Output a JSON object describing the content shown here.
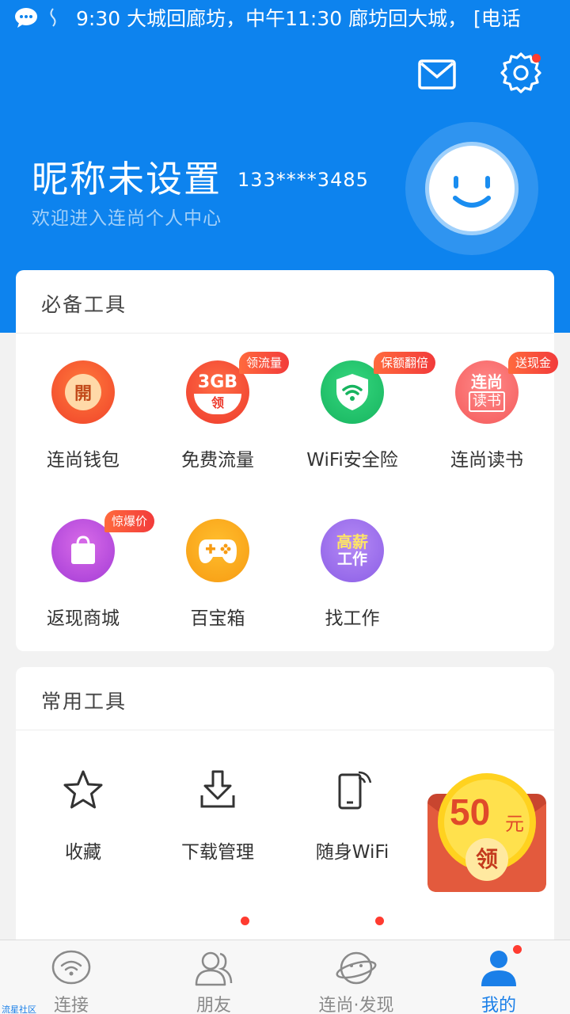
{
  "status_bar": {
    "ticker_text": "9:30 大城回廊坊，中午11:30 廊坊回大城， [电话"
  },
  "profile": {
    "nickname": "昵称未设置",
    "phone": "133****3485",
    "welcome": "欢迎进入连尚个人中心"
  },
  "essential_tools": {
    "title": "必备工具",
    "items": [
      {
        "label": "连尚钱包",
        "icon": "wallet-icon",
        "icon_text": "開",
        "badge": ""
      },
      {
        "label": "免费流量",
        "icon": "3gb-data-icon",
        "icon_text": "3GB",
        "icon_subtext": "领",
        "badge": "领流量"
      },
      {
        "label": "WiFi安全险",
        "icon": "wifi-shield-icon",
        "badge": "保额翻倍"
      },
      {
        "label": "连尚读书",
        "icon": "reading-icon",
        "icon_text": "连尚",
        "icon_subtext": "读书",
        "badge": "送现金"
      },
      {
        "label": "返现商城",
        "icon": "shopping-bag-icon",
        "badge": "惊爆价"
      },
      {
        "label": "百宝箱",
        "icon": "gamepad-icon",
        "badge": ""
      },
      {
        "label": "找工作",
        "icon": "job-icon",
        "icon_text": "高薪",
        "icon_subtext": "工作",
        "badge": ""
      }
    ]
  },
  "common_tools": {
    "title": "常用工具",
    "items": [
      {
        "label": "收藏",
        "icon": "star-icon"
      },
      {
        "label": "下载管理",
        "icon": "download-icon"
      },
      {
        "label": "随身WiFi",
        "icon": "phone-wifi-icon"
      }
    ]
  },
  "floating_pack": {
    "amount": "50",
    "unit": "元",
    "action": "领"
  },
  "tabs": [
    {
      "label": "连接",
      "icon": "wifi-icon",
      "active": false
    },
    {
      "label": "朋友",
      "icon": "friends-icon",
      "active": false
    },
    {
      "label": "连尚·发现",
      "icon": "planet-icon",
      "active": false
    },
    {
      "label": "我的",
      "icon": "user-icon",
      "active": true
    }
  ],
  "watermark": "流星社区",
  "colors": {
    "primary_blue": "#0d83ee",
    "badge_red": "#f23b3b",
    "active_tab": "#1a7fe8"
  }
}
